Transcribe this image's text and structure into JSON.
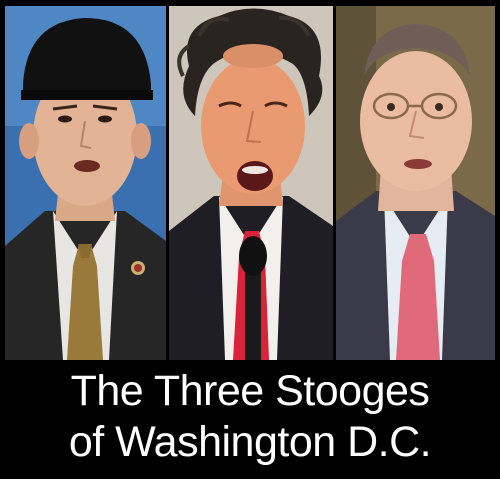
{
  "caption": {
    "line1": "The Three Stooges",
    "line2": "of Washington D.C."
  },
  "colors": {
    "background": "#000000",
    "caption_text": "#ffffff",
    "panel1_backdrop": "#3a6fb0",
    "panel2_backdrop": "#cfc6bb",
    "panel3_backdrop": "#7a6a4a",
    "gold_tie": "#9a7a3a",
    "red_tie": "#d9233a",
    "pink_tie": "#e06a7a"
  },
  "panels": [
    {
      "subject": "man-bowl-haircut-gold-tie"
    },
    {
      "subject": "man-frizzy-hair-microphone"
    },
    {
      "subject": "man-glasses-pink-tie"
    }
  ]
}
